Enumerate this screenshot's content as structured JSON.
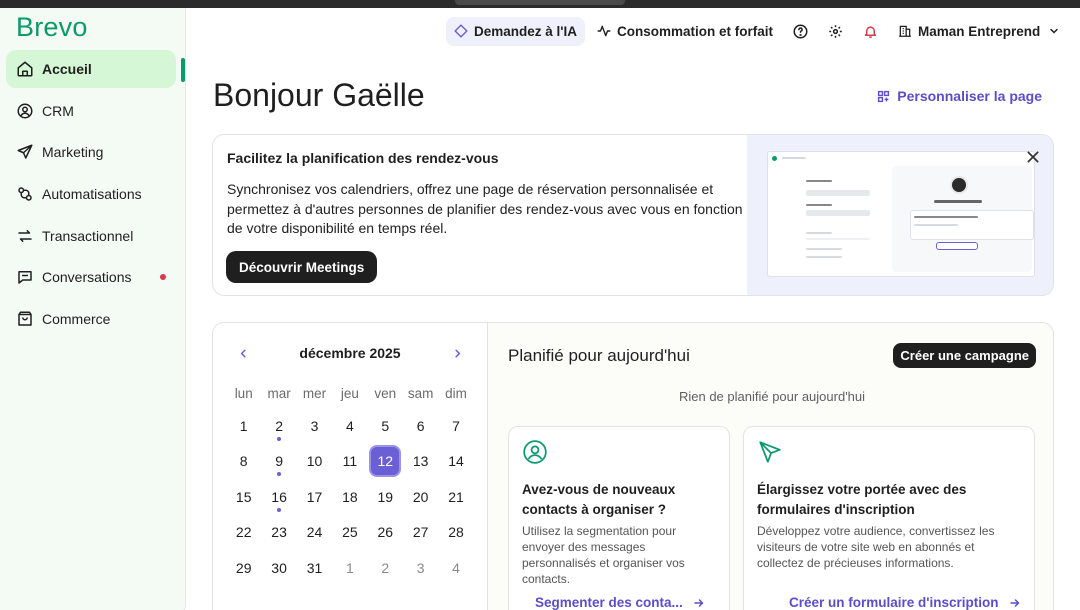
{
  "app": {
    "logo": "Brevo"
  },
  "sidebar": {
    "items": [
      {
        "label": "Accueil",
        "icon": "home-icon"
      },
      {
        "label": "CRM",
        "icon": "user-circle-icon"
      },
      {
        "label": "Marketing",
        "icon": "paper-plane-icon"
      },
      {
        "label": "Automatisations",
        "icon": "automation-icon"
      },
      {
        "label": "Transactionnel",
        "icon": "arrows-swap-icon"
      },
      {
        "label": "Conversations",
        "icon": "chat-icon"
      },
      {
        "label": "Commerce",
        "icon": "shopping-bag-icon"
      }
    ]
  },
  "header": {
    "ai_label": "Demandez à l'IA",
    "plan_label": "Consommation et forfait",
    "account_name": "Maman Entreprend"
  },
  "main": {
    "greeting": "Bonjour Gaëlle",
    "customize_label": "Personnaliser la page"
  },
  "banner": {
    "title": "Facilitez la planification des rendez-vous",
    "text": "Synchronisez vos calendriers, offrez une page de réservation personnalisée et permettez à d'autres personnes de planifier des rendez-vous avec vous en fonction de votre disponibilité en temps réel.",
    "cta": "Découvrir Meetings"
  },
  "calendar": {
    "month": "décembre 2025",
    "weekdays": [
      "lun",
      "mar",
      "mer",
      "jeu",
      "ven",
      "sam",
      "dim"
    ],
    "weeks": [
      [
        "1",
        "2",
        "3",
        "4",
        "5",
        "6",
        "7"
      ],
      [
        "8",
        "9",
        "10",
        "11",
        "12",
        "13",
        "14"
      ],
      [
        "15",
        "16",
        "17",
        "18",
        "19",
        "20",
        "21"
      ],
      [
        "22",
        "23",
        "24",
        "25",
        "26",
        "27",
        "28"
      ],
      [
        "29",
        "30",
        "31",
        "1",
        "2",
        "3",
        "4"
      ]
    ],
    "selected": "12",
    "event_days": [
      "2",
      "9",
      "16"
    ]
  },
  "planned": {
    "title": "Planifié pour aujourd'hui",
    "create_label": "Créer une campagne",
    "empty": "Rien de planifié pour aujourd'hui",
    "cards": [
      {
        "title_l1": "Avez-vous de nouveaux",
        "title_l2": "contacts à organiser ?",
        "d1": "Utilisez la segmentation pour",
        "d2": "envoyer des messages",
        "d3": "personnalisés et organiser vos",
        "d4": "contacts.",
        "link": "Segmenter des conta..."
      },
      {
        "title_l1": "Élargissez votre portée avec des",
        "title_l2": "formulaires d'inscription",
        "d1": "Développez votre audience, convertissez les",
        "d2": "visiteurs de votre site web en abonnés et",
        "d3": "collectez de précieuses informations.",
        "d4": "",
        "link": "Créer un formulaire d'inscription"
      }
    ]
  },
  "colors": {
    "brand": "#0b996e",
    "accent": "#6b5fd6",
    "alert": "#d63b4a"
  }
}
